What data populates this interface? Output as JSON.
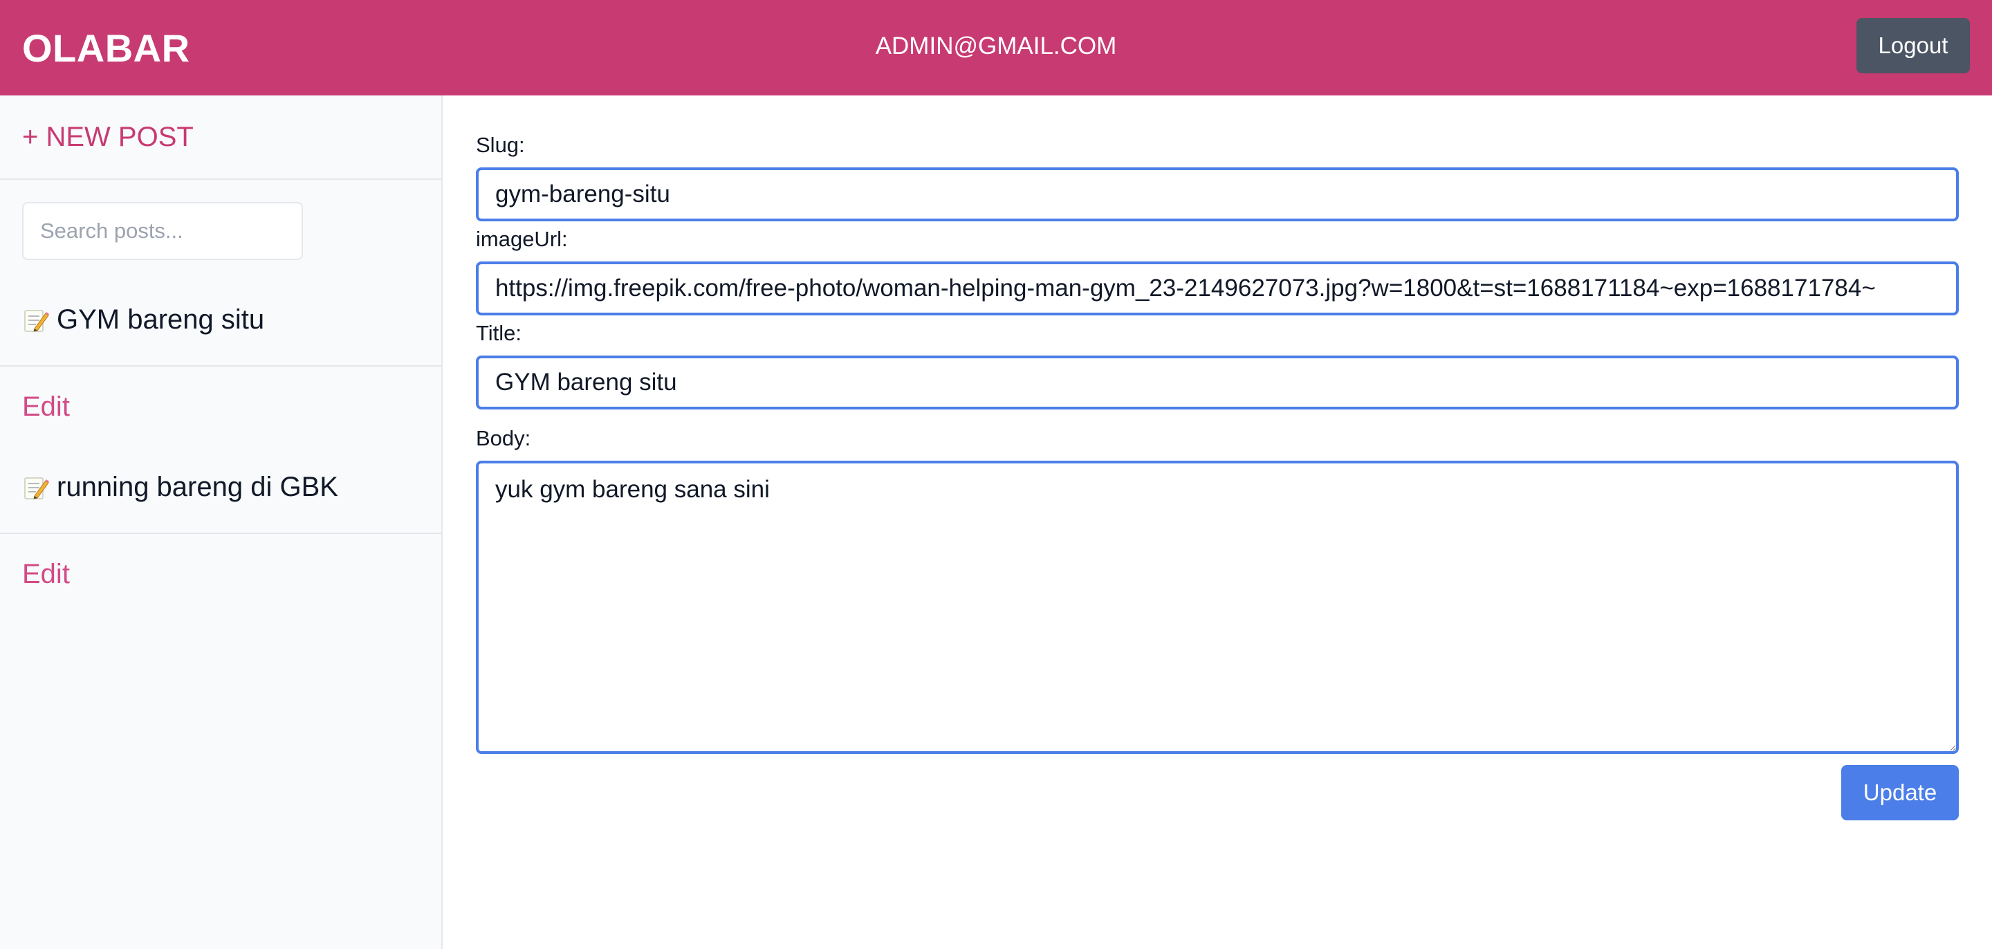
{
  "header": {
    "brand": "OLABAR",
    "user_email": "ADMIN@GMAIL.COM",
    "logout_label": "Logout",
    "background_color": "#c83a72"
  },
  "sidebar": {
    "new_post_label": "+ NEW POST",
    "search_placeholder": "Search posts...",
    "search_value": "",
    "posts": [
      {
        "icon": "memo-icon",
        "title": "GYM bareng situ",
        "edit_label": "Edit"
      },
      {
        "icon": "memo-icon",
        "title": "running bareng di GBK",
        "edit_label": "Edit"
      }
    ]
  },
  "form": {
    "slug_label": "Slug:",
    "slug_value": "gym-bareng-situ",
    "image_url_label": "imageUrl:",
    "image_url_value": "https://img.freepik.com/free-photo/woman-helping-man-gym_23-2149627073.jpg?w=1800&t=st=1688171184~exp=1688171784~",
    "title_label": "Title:",
    "title_value": "GYM bareng situ",
    "body_label": "Body:",
    "body_value": "yuk gym bareng sana sini",
    "update_label": "Update",
    "accent_color": "#4b7ee8"
  }
}
